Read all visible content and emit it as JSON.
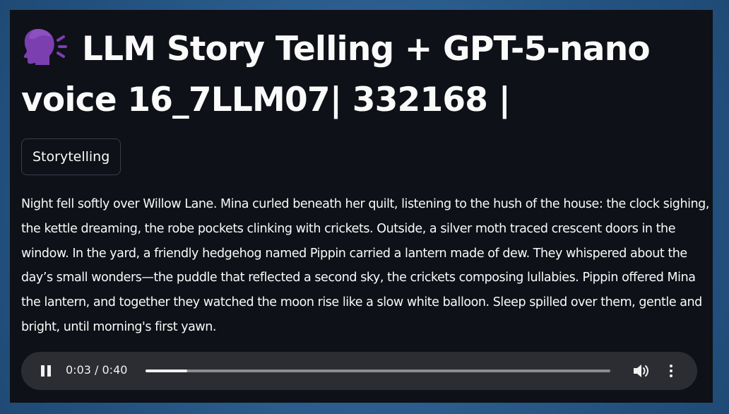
{
  "header": {
    "title_line1": "LLM Story Telling + GPT-5-nano",
    "title_line2": "voice 16_7LLM07| 332168 |",
    "title_icon": "speaking-head-emoji"
  },
  "tabs": [
    {
      "label": "Storytelling"
    }
  ],
  "story": {
    "text": "Night fell softly over Willow Lane. Mina curled beneath her quilt, listening to the hush of the house: the clock sighing, the kettle dreaming, the robe pockets clinking with crickets. Outside, a silver moth traced crescent doors in the window. In the yard, a friendly hedgehog named Pippin carried a lantern made of dew. They whispered about the day’s small wonders—the puddle that reflected a second sky, the crickets composing lullabies. Pippin offered Mina the lantern, and together they watched the moon rise like a slow white balloon. Sleep spilled over them, gentle and bright, until morning's first yawn."
  },
  "audio_player": {
    "state": "playing",
    "play_pause_icon": "pause-icon",
    "time_display": "0:03 / 0:40",
    "progress_fraction": 0.09,
    "volume_icon": "volume-icon",
    "menu_icon": "more-vertical-icon"
  },
  "colors": {
    "app_background": "#0e1117",
    "page_background": "#2b5f93",
    "text": "#fafafa",
    "player_background": "#2b2d32",
    "emoji_purple": "#7b3fb0"
  }
}
